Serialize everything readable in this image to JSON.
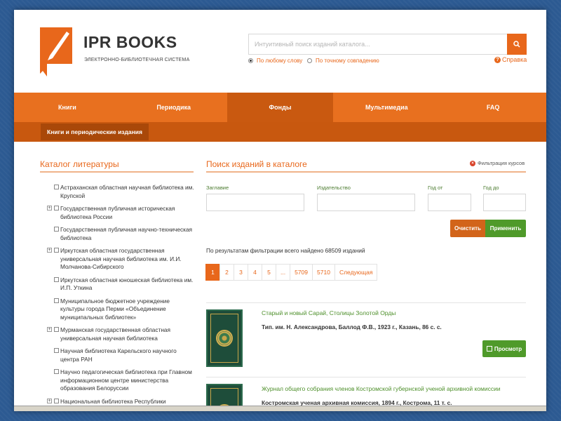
{
  "brand": {
    "title": "IPR BOOKS",
    "subtitle": "ЭЛЕКТРОННО-БИБЛИОТЕЧНАЯ СИСТЕМА",
    "accent": "#e8671b"
  },
  "search": {
    "placeholder": "Интуитивный поиск изданий каталога...",
    "option_any": "По любому слову",
    "option_exact": "По точному совпадению",
    "help_label": "Справка"
  },
  "nav": {
    "items": [
      "Книги",
      "Периодика",
      "Фонды",
      "Мультимедиа",
      "FAQ"
    ],
    "active": "Фонды",
    "sub_item": "Книги и периодические издания"
  },
  "catalog": {
    "title": "Каталог литературы",
    "items": [
      {
        "label": "Астраханская областная научная библиотека им. Крупской",
        "expandable": false
      },
      {
        "label": "Государственная публичная историческая библиотека России",
        "expandable": true
      },
      {
        "label": "Государственная публичная научно-техническая библиотека",
        "expandable": false
      },
      {
        "label": "Иркутская областная государственная универсальная научная библиотека им. И.И. Молчанова-Сибирского",
        "expandable": true
      },
      {
        "label": "Иркутская областная юношеская библиотека им. И.П. Уткина",
        "expandable": false
      },
      {
        "label": "Муниципальное бюджетное учреждение культуры города Перми «Объединение муниципальных библиотек»",
        "expandable": false
      },
      {
        "label": "Мурманская государственная областная универсальная научная библиотека",
        "expandable": true
      },
      {
        "label": "Научная библиотека Карельского научного центра РАН",
        "expandable": false
      },
      {
        "label": "Научно педагогическая библиотека при Главном информационном центре министерства образования Белоруссии",
        "expandable": false
      },
      {
        "label": "Национальная библиотека Республики",
        "expandable": true
      }
    ]
  },
  "filter": {
    "title": "Поиск изданий в каталоге",
    "filter_link": "Фильтрация курсов",
    "label_title": "Заглавие",
    "label_publisher": "Издательство",
    "label_year_from": "Год от",
    "label_year_to": "Год до",
    "clear_label": "Очистить",
    "apply_label": "Применить",
    "result_text": "По результатам фильтрации всего найдено 68509 изданий"
  },
  "pager": {
    "pages": [
      "1",
      "2",
      "3",
      "4",
      "5",
      "...",
      "5709",
      "5710",
      "Следующая"
    ],
    "active": "1"
  },
  "books": [
    {
      "title": "Старый и новый Сарай, Столицы Золотой Орды",
      "meta": "Тип. им. Н. Александрова, Баллод Ф.В., 1923 г., Казань, 86 с. с.",
      "view_label": "Просмотр"
    },
    {
      "title": "Журнал общего собрания членов Костромской губернской ученой архивной комиссии",
      "meta": "Костромская ученая архивная комиссия, 1894 г., Кострома, 11 т. с."
    }
  ]
}
